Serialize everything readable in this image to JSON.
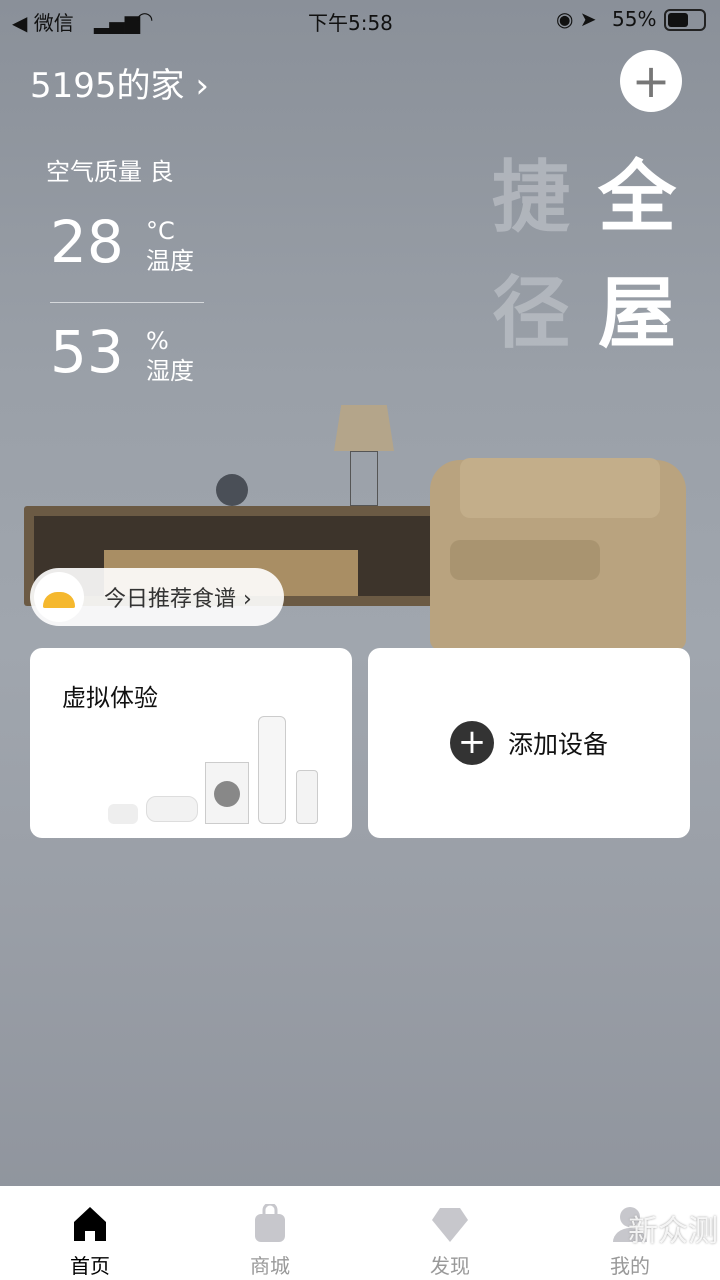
{
  "status_bar": {
    "back_app": "◀ 微信",
    "time": "下午5:58",
    "battery": "55%"
  },
  "header": {
    "home_name": "5195的家 ›",
    "add_icon": "plus-icon"
  },
  "air": {
    "quality": "空气质量 良",
    "temperature": "28",
    "temp_unit": "°C",
    "temp_label": "温度",
    "humidity": "53",
    "hum_unit": "%",
    "hum_label": "湿度"
  },
  "slogan": {
    "col1_top": "捷",
    "col1_bottom": "径",
    "col2_top": "全",
    "col2_bottom": "屋"
  },
  "recipe": {
    "label": "今日推荐食谱 ›",
    "icon": "service-bell-icon"
  },
  "cards": {
    "virtual": "虚拟体验",
    "add_device": "添加设备"
  },
  "tabs": [
    {
      "label": "首页",
      "icon": "home-icon",
      "active": true
    },
    {
      "label": "商城",
      "icon": "shopping-bag-icon"
    },
    {
      "label": "发现",
      "icon": "diamond-icon"
    },
    {
      "label": "我的",
      "icon": "user-icon"
    }
  ],
  "watermark": "新众测",
  "colors": {
    "active_tab": "#000000",
    "inactive_tab": "#c7c7cc",
    "bell": "#f5b82e"
  }
}
